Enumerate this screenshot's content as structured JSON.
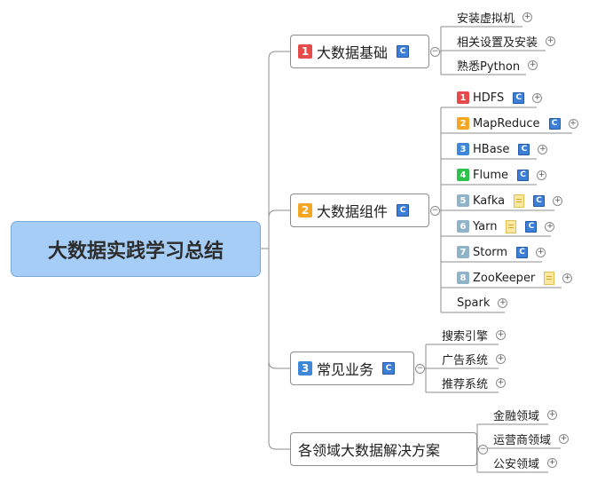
{
  "root": {
    "label": "大数据实践学习总结"
  },
  "colors": {
    "1": "#e54b4b",
    "2": "#f5a623",
    "3": "#3f87d9",
    "4": "#2ec24a",
    "5": "#8fb3c9",
    "6": "#8fb3c9",
    "7": "#8fb3c9",
    "8": "#8fb3c9"
  },
  "topics": [
    {
      "badge": "1",
      "label": "大数据基础",
      "has_c": true,
      "children": [
        {
          "label": "安装虚拟机"
        },
        {
          "label": "相关设置及安装"
        },
        {
          "label": "熟悉Python"
        }
      ]
    },
    {
      "badge": "2",
      "label": "大数据组件",
      "has_c": true,
      "children": [
        {
          "badge": "1",
          "label": "HDFS",
          "has_c": true
        },
        {
          "badge": "2",
          "label": "MapReduce",
          "has_c": true
        },
        {
          "badge": "3",
          "label": "HBase",
          "has_c": true
        },
        {
          "badge": "4",
          "label": "Flume",
          "has_c": true
        },
        {
          "badge": "5",
          "label": "Kafka",
          "has_note": true,
          "has_c": true
        },
        {
          "badge": "6",
          "label": "Yarn",
          "has_note": true,
          "has_c": true
        },
        {
          "badge": "7",
          "label": "Storm",
          "has_c": true
        },
        {
          "badge": "8",
          "label": "ZooKeeper",
          "has_note": true
        },
        {
          "label": "Spark"
        }
      ]
    },
    {
      "badge": "3",
      "label": "常见业务",
      "has_c": true,
      "children": [
        {
          "label": "搜索引擎"
        },
        {
          "label": "广告系统"
        },
        {
          "label": "推荐系统"
        }
      ]
    },
    {
      "label": "各领域大数据解决方案",
      "children": [
        {
          "label": "金融领域"
        },
        {
          "label": "运营商领域"
        },
        {
          "label": "公安领域"
        }
      ]
    }
  ]
}
